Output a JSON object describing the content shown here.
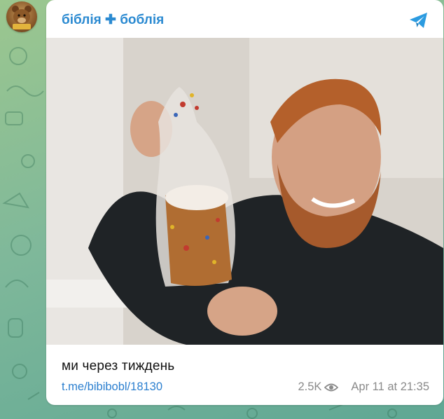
{
  "channel": {
    "name": "біблія ✚ боблія"
  },
  "post": {
    "caption": "ми через тиждень",
    "link": "t.me/bibibobl/18130",
    "views": "2.5K",
    "date": "Apr 11 at 21:35"
  },
  "colors": {
    "accent": "#2b8ad1",
    "link": "#2b7fcf",
    "meta": "#8a8a8a",
    "background": "#7fb89a"
  },
  "icons": [
    "channel-avatar",
    "telegram-icon",
    "eye-icon"
  ]
}
